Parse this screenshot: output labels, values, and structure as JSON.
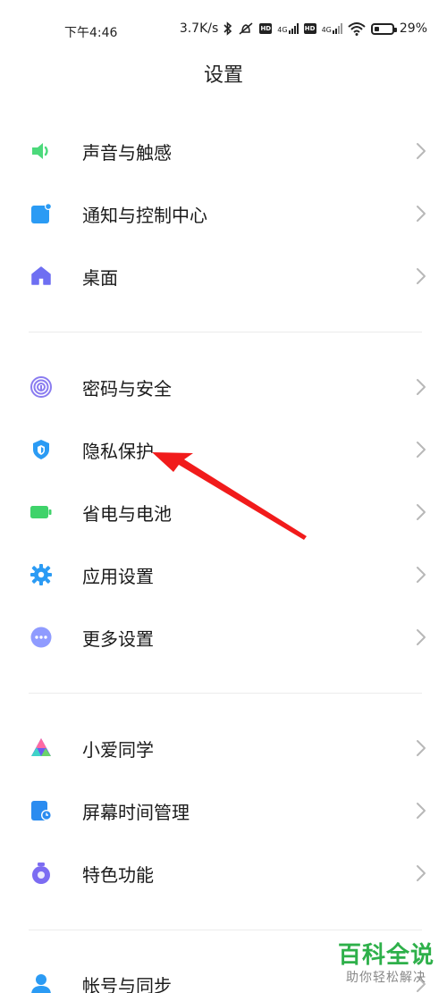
{
  "status_bar": {
    "time": "下午4:46",
    "speed": "3.7K/s",
    "hd1": "HD",
    "net1": "4G",
    "hd2": "HD",
    "net2": "4G",
    "battery_percent": "29%",
    "battery_level": 0.29
  },
  "header": {
    "title": "设置"
  },
  "groups": [
    {
      "items": [
        {
          "label": "声音与触感",
          "icon": "speaker-icon",
          "color": "#4cd97b"
        },
        {
          "label": "通知与控制中心",
          "icon": "notification-icon",
          "color": "#2b9bf4"
        },
        {
          "label": "桌面",
          "icon": "home-icon",
          "color": "#6e6ff2"
        }
      ]
    },
    {
      "items": [
        {
          "label": "密码与安全",
          "icon": "fingerprint-icon",
          "color": "#8a7cf0"
        },
        {
          "label": "隐私保护",
          "icon": "shield-icon",
          "color": "#2b9bf4"
        },
        {
          "label": "省电与电池",
          "icon": "battery-icon",
          "color": "#3fd36a"
        },
        {
          "label": "应用设置",
          "icon": "gear-icon",
          "color": "#2b9bf4"
        },
        {
          "label": "更多设置",
          "icon": "more-icon",
          "color": "#8f9bff"
        }
      ]
    },
    {
      "items": [
        {
          "label": "小爱同学",
          "icon": "xiaoai-icon",
          "color": "#6a5cf0"
        },
        {
          "label": "屏幕时间管理",
          "icon": "screen-time-icon",
          "color": "#2b8cf0"
        },
        {
          "label": "特色功能",
          "icon": "feature-icon",
          "color": "#7c6cf2"
        }
      ]
    },
    {
      "items": [
        {
          "label": "帐号与同步",
          "icon": "account-icon",
          "color": "#2b9bf4"
        }
      ]
    }
  ],
  "watermark": {
    "main": "百科全说",
    "sub": "助你轻松解决"
  }
}
